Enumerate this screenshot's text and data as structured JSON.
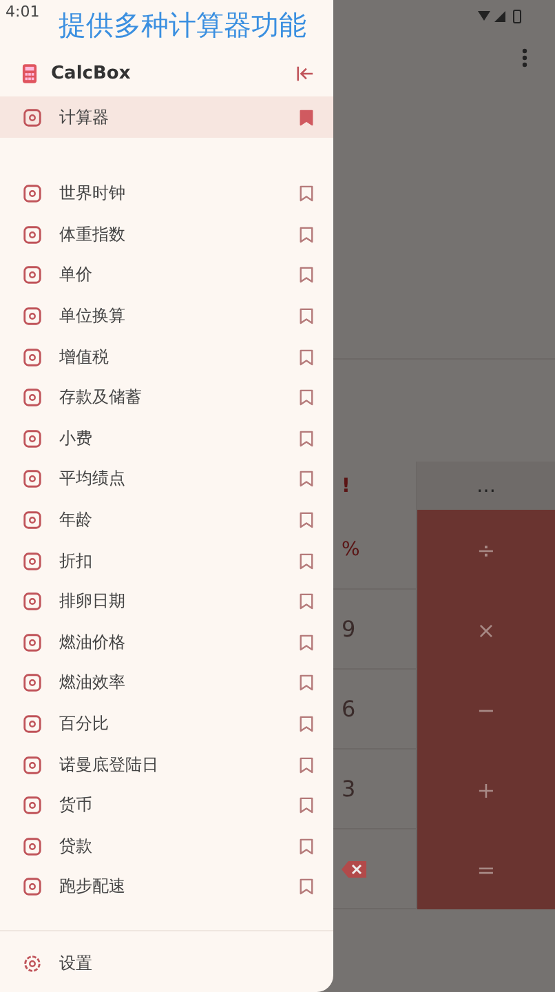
{
  "status_bar": {
    "time": "4:01"
  },
  "caption": "提供多种计算器功能",
  "drawer": {
    "app_name": "CalcBox",
    "pinned": {
      "label": "计算器",
      "selected": true,
      "bookmarked": true
    },
    "items": [
      {
        "label": "世界时钟",
        "selected": false,
        "bookmarked": false
      },
      {
        "label": "体重指数",
        "selected": false,
        "bookmarked": false
      },
      {
        "label": "单价",
        "selected": false,
        "bookmarked": false
      },
      {
        "label": "单位换算",
        "selected": false,
        "bookmarked": false
      },
      {
        "label": "增值税",
        "selected": false,
        "bookmarked": false
      },
      {
        "label": "存款及储蓄",
        "selected": false,
        "bookmarked": false
      },
      {
        "label": "小费",
        "selected": false,
        "bookmarked": false
      },
      {
        "label": "平均绩点",
        "selected": false,
        "bookmarked": false
      },
      {
        "label": "年龄",
        "selected": false,
        "bookmarked": false
      },
      {
        "label": "折扣",
        "selected": false,
        "bookmarked": false
      },
      {
        "label": "排卵日期",
        "selected": false,
        "bookmarked": false
      },
      {
        "label": "燃油价格",
        "selected": false,
        "bookmarked": false
      },
      {
        "label": "燃油效率",
        "selected": false,
        "bookmarked": false
      },
      {
        "label": "百分比",
        "selected": false,
        "bookmarked": false
      },
      {
        "label": "诺曼底登陆日",
        "selected": false,
        "bookmarked": false
      },
      {
        "label": "货币",
        "selected": false,
        "bookmarked": false
      },
      {
        "label": "贷款",
        "selected": false,
        "bookmarked": false
      },
      {
        "label": "跑步配速",
        "selected": false,
        "bookmarked": false
      }
    ],
    "settings": "设置"
  },
  "keypad": {
    "top_row": [
      "!",
      "…"
    ],
    "left_keys": [
      "%",
      "9",
      "6",
      "3"
    ],
    "operators": [
      "÷",
      "×",
      "−",
      "+",
      "="
    ]
  }
}
